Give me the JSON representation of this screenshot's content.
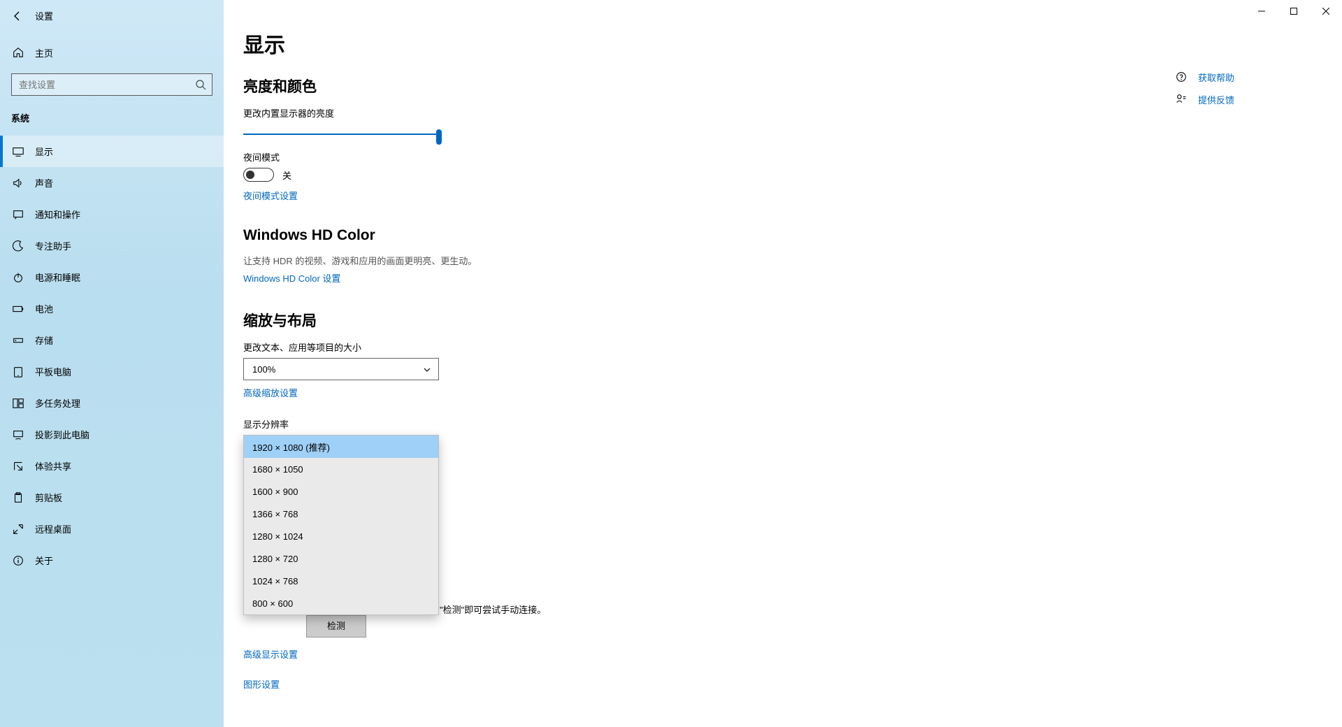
{
  "window": {
    "title": "设置"
  },
  "sidebar": {
    "home": "主页",
    "search_placeholder": "查找设置",
    "group": "系统",
    "items": [
      {
        "label": "显示"
      },
      {
        "label": "声音"
      },
      {
        "label": "通知和操作"
      },
      {
        "label": "专注助手"
      },
      {
        "label": "电源和睡眠"
      },
      {
        "label": "电池"
      },
      {
        "label": "存储"
      },
      {
        "label": "平板电脑"
      },
      {
        "label": "多任务处理"
      },
      {
        "label": "投影到此电脑"
      },
      {
        "label": "体验共享"
      },
      {
        "label": "剪贴板"
      },
      {
        "label": "远程桌面"
      },
      {
        "label": "关于"
      }
    ]
  },
  "page": {
    "title": "显示"
  },
  "brightness": {
    "heading": "亮度和颜色",
    "label": "更改内置显示器的亮度",
    "night_label": "夜间模式",
    "night_state": "关",
    "night_link": "夜间模式设置"
  },
  "hdcolor": {
    "heading": "Windows HD Color",
    "desc": "让支持 HDR 的视频、游戏和应用的画面更明亮、更生动。",
    "link": "Windows HD Color 设置"
  },
  "scale": {
    "heading": "缩放与布局",
    "scale_label": "更改文本、应用等项目的大小",
    "scale_value": "100%",
    "adv_scale_link": "高级缩放设置",
    "res_label": "显示分辨率",
    "res_options": [
      "1920 × 1080 (推荐)",
      "1680 × 1050",
      "1600 × 900",
      "1366 × 768",
      "1280 × 1024",
      "1280 × 720",
      "1024 × 768",
      "800 × 600"
    ],
    "detect_hint_tail": "\"检测\"即可尝试手动连接。",
    "detect_btn": "检测",
    "adv_display_link": "高级显示设置",
    "graphics_link": "图形设置"
  },
  "rside": {
    "help": "获取帮助",
    "feedback": "提供反馈"
  }
}
